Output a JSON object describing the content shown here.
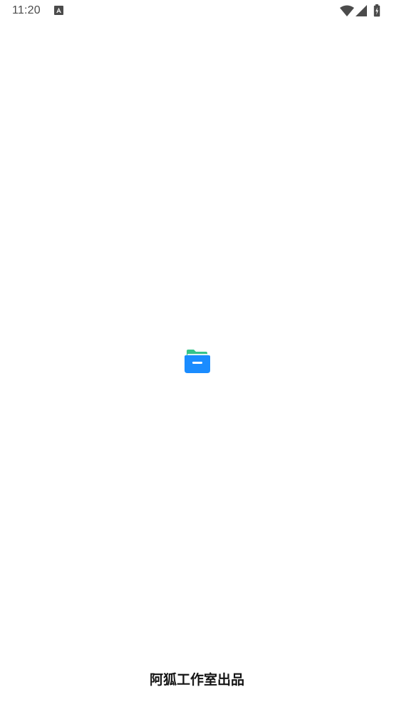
{
  "status_bar": {
    "time": "11:20",
    "icons": {
      "notification": "a-notification-icon",
      "wifi": "wifi-icon",
      "signal": "cell-signal-icon",
      "battery": "battery-charging-icon"
    }
  },
  "splash": {
    "logo": "folder-icon",
    "credit": "阿狐工作室出品"
  },
  "colors": {
    "background": "#ffffff",
    "status_icon": "#4b4b4b",
    "folder_blue": "#1a8cff",
    "folder_green": "#35c48a",
    "credit_text": "#141414"
  }
}
